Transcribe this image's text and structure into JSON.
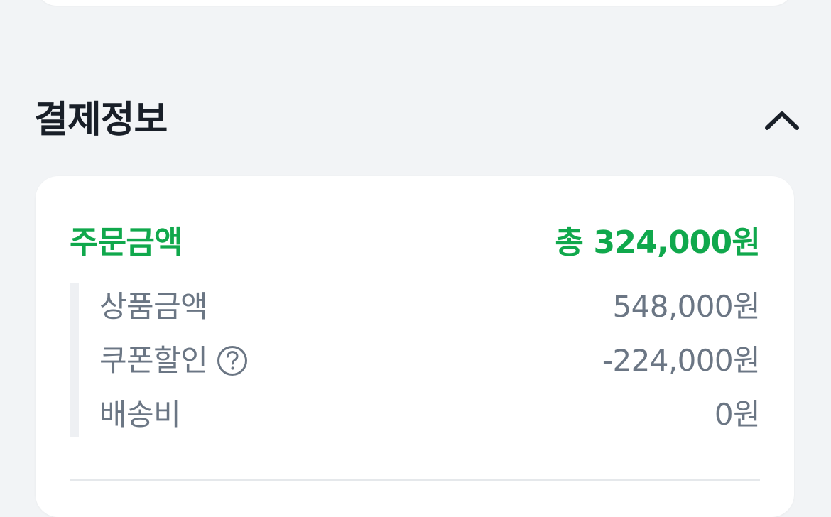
{
  "payment_info": {
    "title": "결제정보",
    "collapse_icon": "chevron-up-icon",
    "summary": {
      "label": "주문금액",
      "value": "총 324,000원"
    },
    "details": {
      "product": {
        "label": "상품금액",
        "value": "548,000원"
      },
      "coupon": {
        "label": "쿠폰할인",
        "value": "-224,000원",
        "help_icon": "question-circle-icon"
      },
      "shipping": {
        "label": "배송비",
        "value": "0원"
      }
    }
  },
  "colors": {
    "background": "#f2f4f6",
    "card": "#ffffff",
    "title": "#191f28",
    "accent": "#10a84c",
    "secondary_text": "#6b7684",
    "rail": "#eef0f3",
    "divider": "#e5e8eb"
  }
}
